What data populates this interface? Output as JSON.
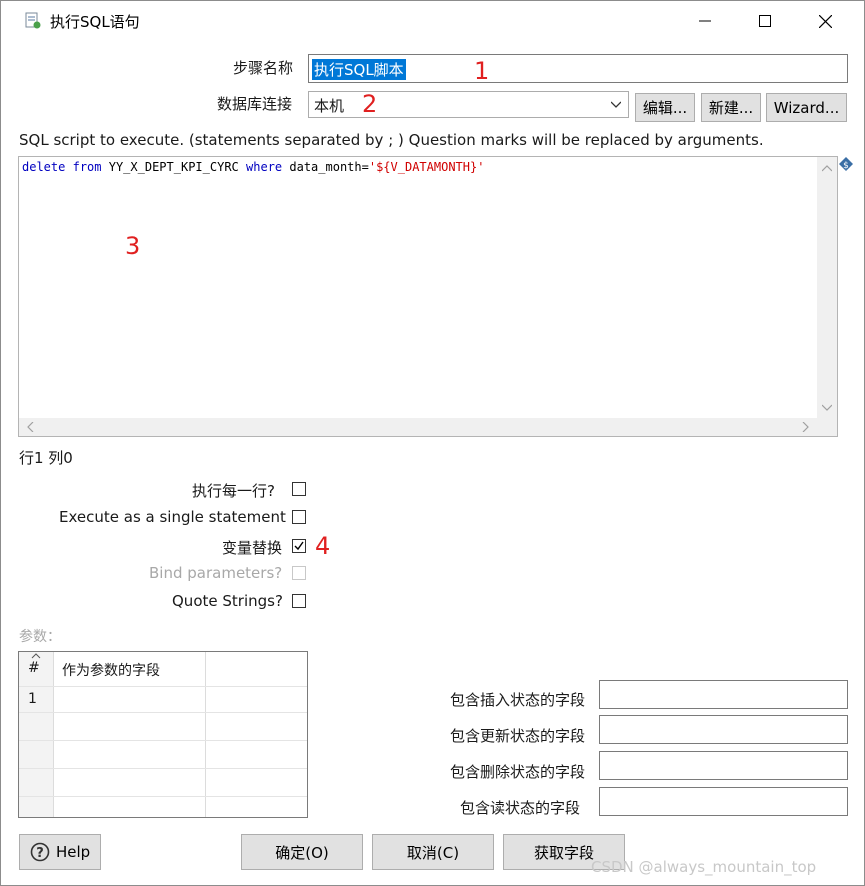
{
  "window": {
    "title": "执行SQL语句",
    "icons": {
      "app": "sql-script-icon",
      "minimize": "minimize-icon",
      "maximize": "maximize-icon",
      "close": "close-icon"
    }
  },
  "form": {
    "step_name_label": "步骤名称",
    "step_name_value": "执行SQL脚本",
    "connection_label": "数据库连接",
    "connection_value": "本机",
    "edit_button": "编辑...",
    "new_button": "新建...",
    "wizard_button": "Wizard...",
    "sql_description": "SQL script to execute. (statements separated by ; ) Question marks will be replaced by arguments."
  },
  "sql_editor": {
    "kw_delete": "delete",
    "kw_from": "from",
    "table": "YY_X_DEPT_KPI_CYRC",
    "kw_where": "where",
    "column": "data_month=",
    "value": "'${V_DATAMONTH}'",
    "cursor_pos": "行1 列0"
  },
  "options": {
    "execute_each_row": "执行每一行?",
    "single_statement": "Execute as a single statement",
    "variable_substitution": "变量替换",
    "bind_parameters": "Bind parameters?",
    "quote_strings": "Quote Strings?",
    "states": {
      "execute_each_row": false,
      "single_statement": false,
      "variable_substitution": true,
      "bind_parameters": false,
      "quote_strings": false
    }
  },
  "parameters": {
    "label": "参数：",
    "columns": [
      "#",
      "作为参数的字段"
    ],
    "rows": [
      [
        "1",
        ""
      ]
    ]
  },
  "status_fields": {
    "insert_label": "包含插入状态的字段",
    "update_label": "包含更新状态的字段",
    "delete_label": "包含删除状态的字段",
    "read_label": "包含读状态的字段"
  },
  "annotations": [
    "1",
    "2",
    "3",
    "4"
  ],
  "buttons": {
    "help": "Help",
    "ok": "确定(O)",
    "cancel": "取消(C)",
    "get_fields": "获取字段"
  },
  "watermark": "CSDN @always_mountain_top"
}
